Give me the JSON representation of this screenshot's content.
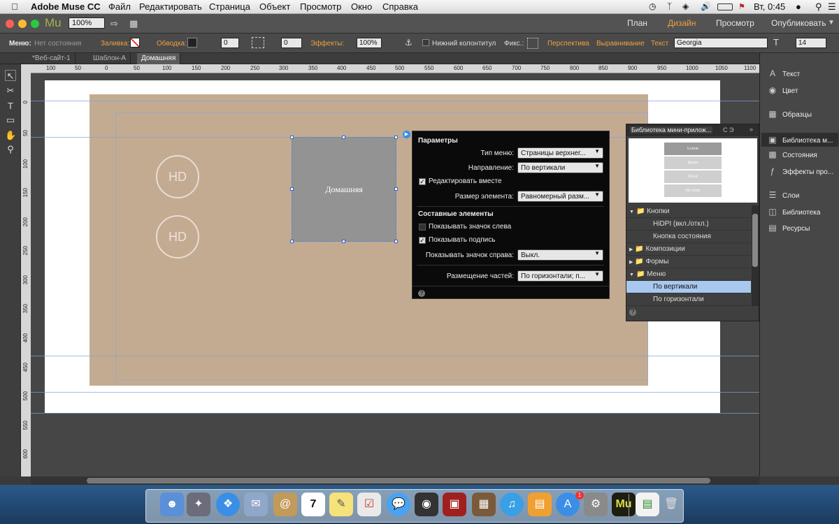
{
  "menubar": {
    "app_name": "Adobe Muse CC",
    "items": [
      "Файл",
      "Редактировать",
      "Страница",
      "Объект",
      "Просмотр",
      "Окно",
      "Справка"
    ],
    "clock": "Вт, 0:45"
  },
  "appbar": {
    "logo": "Mu",
    "zoom": "100%",
    "workspaces": [
      "План",
      "Дизайн",
      "Просмотр",
      "Опубликовать"
    ],
    "active_workspace": "Дизайн"
  },
  "options": {
    "menu_label": "Меню:",
    "state": "Нет состояния",
    "fill": "Заливка:",
    "stroke": "Обводка:",
    "stroke_value": "0",
    "spacing_value": "0",
    "effects": "Эффекты:",
    "opacity": "100%",
    "footer": "Нижний колонтитул",
    "fix": "Фикс.:",
    "perspective": "Перспектива",
    "align": "Выравнивание",
    "text": "Текст",
    "font": "Georgia",
    "font_size": "14"
  },
  "tabs": [
    {
      "label": "*Веб-сайт-1",
      "active": false
    },
    {
      "label": "Шаблон-A",
      "active": false
    },
    {
      "label": "Домашняя",
      "active": true
    }
  ],
  "ruler_h": [
    "100",
    "50",
    "0",
    "50",
    "100",
    "150",
    "200",
    "250",
    "300",
    "350",
    "400",
    "450",
    "500",
    "550",
    "600",
    "650",
    "700",
    "750",
    "800",
    "850",
    "900",
    "950",
    "1000",
    "1050",
    "1100"
  ],
  "ruler_v": [
    "0",
    "50",
    "100",
    "150",
    "200",
    "250",
    "300",
    "350",
    "400",
    "450",
    "500",
    "550",
    "600"
  ],
  "canvas": {
    "hd1": "HD",
    "hd2": "HD",
    "nav_label": "Домашняя"
  },
  "params": {
    "title": "Параметры",
    "menu_type_label": "Тип меню:",
    "menu_type": "Страницы верхнег...",
    "direction_label": "Направление:",
    "direction": "По вертикали",
    "edit_together": "Редактировать вместе",
    "item_size_label": "Размер элемента:",
    "item_size": "Равномерный разм...",
    "parts_title": "Составные элементы",
    "show_left_icon": "Показывать значок слева",
    "show_caption": "Показывать подпись",
    "show_right_icon_label": "Показывать значок справа:",
    "show_right_icon": "Выкл.",
    "parts_placement_label": "Размещение частей:",
    "parts_placement": "По горизонтали; п...",
    "help": "?"
  },
  "library": {
    "title": "Библиотека мини-прилож...",
    "tab2": "С Э",
    "preview_items": [
      "Lorem",
      "Ipsum",
      "Dolor",
      "Sit Amet"
    ],
    "rows": [
      {
        "label": "Кнопки",
        "type": "folder-open"
      },
      {
        "label": "HiDPI (вкл./откл.)",
        "type": "item"
      },
      {
        "label": "Кнопка состояния",
        "type": "item"
      },
      {
        "label": "Композиции",
        "type": "folder"
      },
      {
        "label": "Формы",
        "type": "folder"
      },
      {
        "label": "Меню",
        "type": "folder-open"
      },
      {
        "label": "По вертикали",
        "type": "item-selected"
      },
      {
        "label": "По горизонтали",
        "type": "item"
      }
    ]
  },
  "right_panel": [
    {
      "label": "Текст",
      "icon": "text-icon"
    },
    {
      "label": "Цвет",
      "icon": "color-icon"
    },
    {
      "label": "Образцы",
      "icon": "swatches-icon"
    },
    {
      "label": "Библиотека м...",
      "icon": "widget-library-icon"
    },
    {
      "label": "Состояния",
      "icon": "states-icon"
    },
    {
      "label": "Эффекты про...",
      "icon": "effects-icon"
    },
    {
      "label": "Слои",
      "icon": "layers-icon"
    },
    {
      "label": "Библиотека",
      "icon": "library-icon"
    },
    {
      "label": "Ресурсы",
      "icon": "assets-icon"
    }
  ],
  "dock_calendar_day": "7",
  "dock_badge": "1"
}
